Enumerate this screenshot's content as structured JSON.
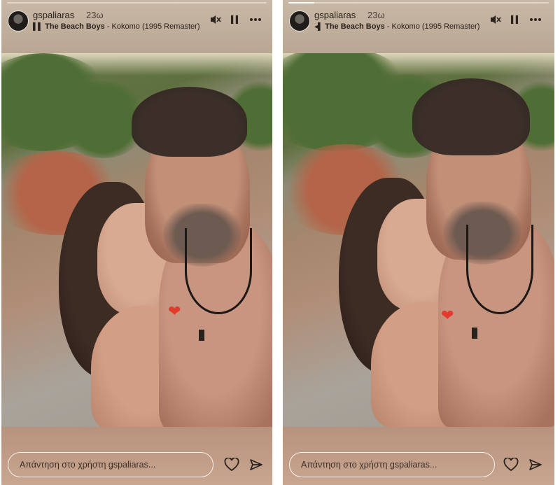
{
  "stories": [
    {
      "username": "gspaliaras",
      "time": "23ω",
      "music": {
        "artist": "The Beach Boys",
        "song": "Kokomo (1995 Remaster)"
      },
      "progress": 0.0,
      "reply_placeholder": "Απάντηση στο χρήστη gspaliaras..."
    },
    {
      "username": "gspaliaras",
      "time": "23ω",
      "music": {
        "artist": "The Beach Boys",
        "song": "Kokomo (1995 Remaster)"
      },
      "progress": 0.1,
      "reply_placeholder": "Απάντηση στο χρήστη gspaliaras..."
    }
  ],
  "icons": {
    "mute": "speaker-muted-icon",
    "pause": "pause-icon",
    "more": "more-options-icon",
    "like": "heart-outline-icon",
    "send": "send-icon",
    "music": "music-note-icon",
    "sticker": "red-heart-emoji"
  },
  "colors": {
    "topbar": "#c8b8a6",
    "bottombar": "#b8927c",
    "sticker": "#e23b2c"
  },
  "separator": " - "
}
